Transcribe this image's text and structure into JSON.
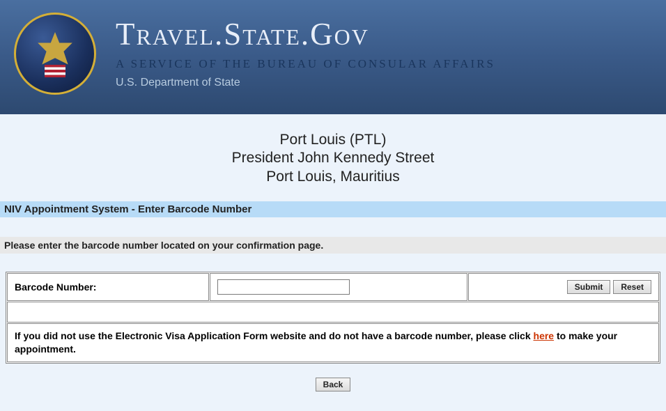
{
  "header": {
    "site_title": "Travel.State.Gov",
    "subtitle": "A SERVICE OF THE BUREAU OF CONSULAR AFFAIRS",
    "dept": "U.S. Department of State"
  },
  "location": {
    "line1": "Port Louis (PTL)",
    "line2": "President John Kennedy Street",
    "line3": "Port Louis, Mauritius"
  },
  "section_title": "NIV Appointment System - Enter Barcode Number",
  "instruction": "Please enter the barcode number located on your confirmation page.",
  "form": {
    "barcode_label": "Barcode Number:",
    "barcode_value": "",
    "submit_label": "Submit",
    "reset_label": "Reset",
    "info_pre": "If you did not use the Electronic Visa Application Form website and do not have a barcode number, please click ",
    "info_link": "here",
    "info_post": " to make your appointment."
  },
  "back_label": "Back"
}
